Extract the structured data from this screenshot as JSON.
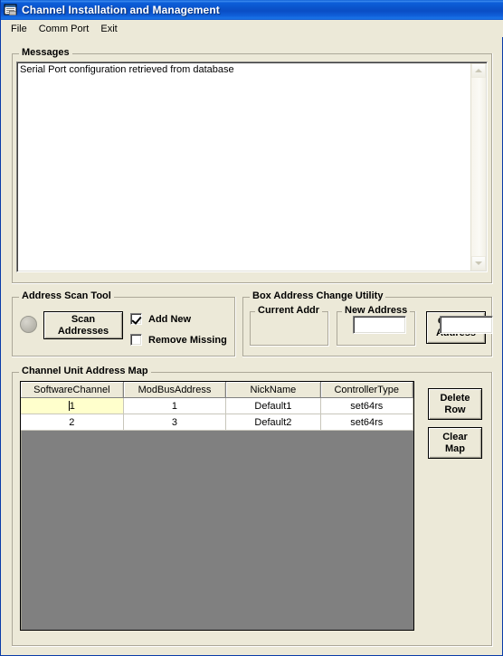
{
  "window": {
    "title": "Channel Installation and Management",
    "icon": "application-window-icon"
  },
  "menu": {
    "items": [
      {
        "label": "File"
      },
      {
        "label": "Comm Port"
      },
      {
        "label": "Exit"
      }
    ]
  },
  "messages": {
    "legend": "Messages",
    "text": "Serial Port configuration retrieved from database",
    "scrollbar": {
      "up": "scroll-up-arrow",
      "down": "scroll-down-arrow"
    }
  },
  "address_scan_tool": {
    "legend": "Address Scan Tool",
    "scan_button": "Scan\nAddresses",
    "scan_button_line1": "Scan",
    "scan_button_line2": "Addresses",
    "led_state": "off",
    "checkboxes": [
      {
        "label": "Add New",
        "checked": true
      },
      {
        "label": "Remove Missing",
        "checked": false
      }
    ]
  },
  "box_address_change_utility": {
    "legend": "Box Address Change Utility",
    "current_addr": {
      "legend": "Current Addr",
      "value": "",
      "placeholder": ""
    },
    "new_address": {
      "legend": "New Address",
      "value": "",
      "placeholder": ""
    },
    "change_button_line1": "Change",
    "change_button_line2": "Address"
  },
  "channel_unit_address_map": {
    "legend": "Channel Unit Address Map",
    "columns": [
      "SoftwareChannel",
      "ModBusAddress",
      "NickName",
      "ControllerType"
    ],
    "rows": [
      {
        "SoftwareChannel": "1",
        "ModBusAddress": "1",
        "NickName": "Default1",
        "ControllerType": "set64rs",
        "selected_cell": 0
      },
      {
        "SoftwareChannel": "2",
        "ModBusAddress": "3",
        "NickName": "Default2",
        "ControllerType": "set64rs",
        "selected_cell": -1
      }
    ],
    "delete_row_line1": "Delete",
    "delete_row_line2": "Row",
    "clear_map_line1": "Clear",
    "clear_map_line2": "Map"
  },
  "colors": {
    "window_background": "#ECE9D8",
    "title_bar_blue": "#0A53CB",
    "grid_empty_area": "#808080",
    "selected_cell": "#FFFFCC",
    "text_field_background": "#FFFFFF"
  }
}
